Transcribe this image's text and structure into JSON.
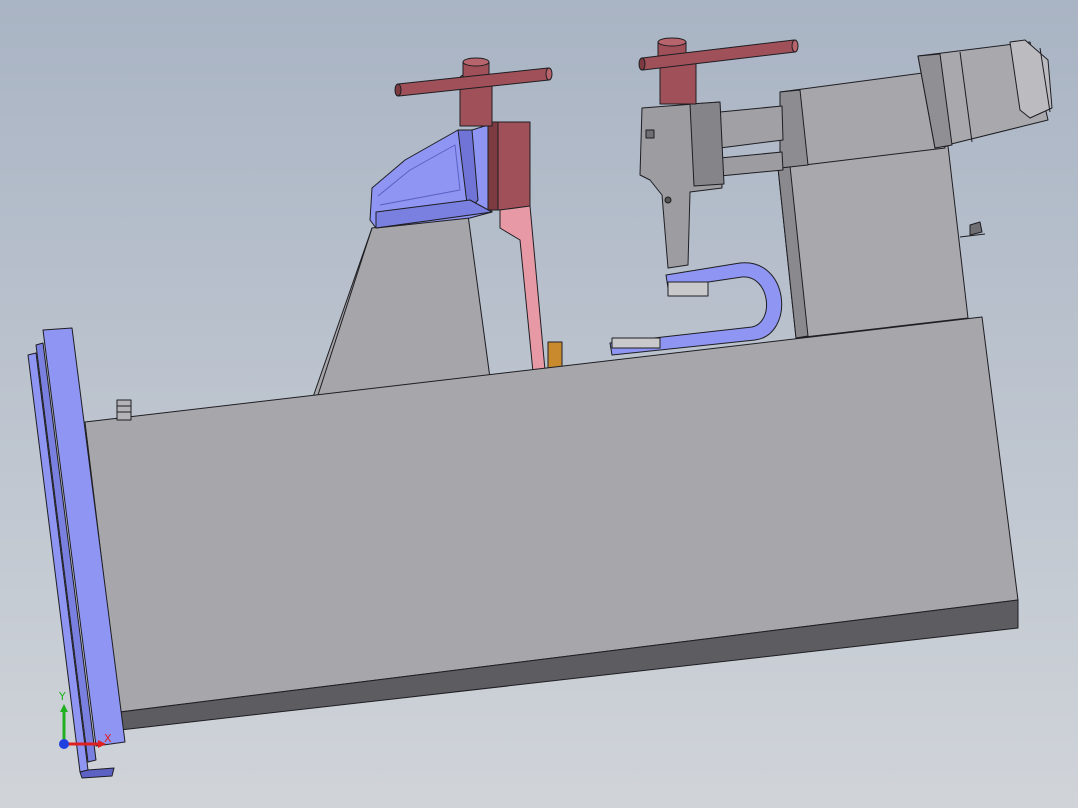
{
  "viewport": {
    "background_top": "#a9b4c4",
    "background_bottom": "#d0d4d9"
  },
  "colors": {
    "base_gray": "#a7a6ab",
    "base_dark": "#6f6e72",
    "base_bottom": "#5d5c60",
    "blue_part": "#8f95f2",
    "blue_dark": "#5c61c4",
    "handle_red": "#a05058",
    "handle_dark": "#7c3a41",
    "pink_arm": "#e79aa5",
    "orange_tab": "#c98a2e",
    "cylinder_gray": "#a8a8ad",
    "edge": "#1e1e22"
  },
  "triad": {
    "x_label": "X",
    "y_label": "Y",
    "x_color": "#e02020",
    "y_color": "#20b020",
    "z_color": "#2040e0"
  },
  "icons": [
    "coordinate-triad-icon"
  ]
}
